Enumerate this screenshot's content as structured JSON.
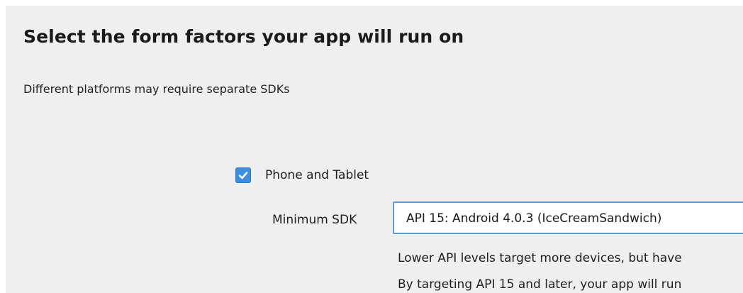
{
  "header": {
    "title": "Select the form factors your app will run on",
    "subtitle": "Different platforms may require separate SDKs"
  },
  "form_factor": {
    "checkbox_label": "Phone and Tablet",
    "checked": true,
    "minimum_sdk_label": "Minimum SDK",
    "minimum_sdk_value": "API 15: Android 4.0.3 (IceCreamSandwich)",
    "help_line_1": "Lower API levels target more devices, but have",
    "help_line_2": "By targeting API 15 and later, your app will run"
  },
  "colors": {
    "background": "#efefef",
    "checkbox_fill": "#3a8ee6",
    "select_border": "#5c9be0"
  },
  "icons": {
    "checkbox_mark": "checkmark-icon"
  }
}
